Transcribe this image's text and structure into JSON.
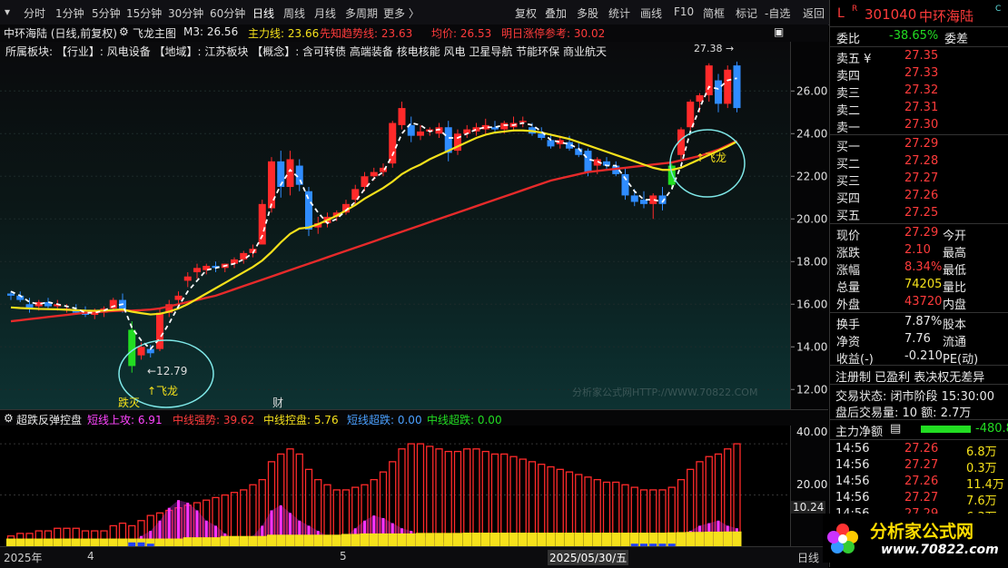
{
  "toolbar": {
    "left_tabs": [
      "分时",
      "1分钟",
      "5分钟",
      "15分钟",
      "30分钟",
      "60分钟",
      "日线",
      "周线",
      "月线",
      "多周期",
      "更多 〉"
    ],
    "active_tab": "日线",
    "right_tabs": [
      "复权",
      "叠加",
      "多股",
      "统计",
      "画线",
      "F10",
      "简框",
      "标记",
      "-自选",
      "返回"
    ]
  },
  "header": {
    "flag": "L",
    "flag_sup": "R",
    "code": "301040",
    "name": "中环海陆",
    "corner_mark": "C"
  },
  "infobar": {
    "title": "中环海陆 (日线,前复权)",
    "indicator": "飞龙主图",
    "m3": "M3: 26.56",
    "main_line": "主力线: 23.66",
    "trend_line": "先知趋势线: 23.63",
    "avg_price": "均价: 26.53",
    "tomorrow_ref": "明日涨停参考: 30.02"
  },
  "sector": "所属板块:  【行业】: 风电设备 【地域】: 江苏板块 【概念】: 含可转债 高端装备 核电核能 风电 卫星导航 节能环保 商业航天",
  "price_axis": [
    "26.00",
    "24.00",
    "22.00",
    "20.00",
    "18.00",
    "16.00",
    "14.00",
    "12.00"
  ],
  "annotations": {
    "high": "27.38",
    "low": "12.79",
    "feilong1": "飞龙",
    "feilong2": "飞龙",
    "die_mie": "跌灭",
    "cai": "财",
    "watermark": "分析家公式网HTTP://WWW.70822.COM"
  },
  "sub_indicator": {
    "name": "超跌反弹控盘",
    "short_up": "短线上攻: 6.91",
    "mid_strong": "中线强势: 39.62",
    "mid_control": "中线控盘: 5.76",
    "short_oversold": "短线超跌: 0.00",
    "mid_oversold": "中线超跌: 0.00"
  },
  "sub_axis": [
    "40.00",
    "20.00",
    "10.24"
  ],
  "dates": {
    "year": "2025年",
    "m4": "4",
    "m5": "5",
    "cursor": "2025/05/30/五",
    "right": "日线"
  },
  "orderbook": {
    "wei_bi_label": "委比",
    "wei_bi": "-38.65%",
    "wei_cha_label": "委差",
    "asks": [
      {
        "label": "卖五 ¥",
        "price": "27.35"
      },
      {
        "label": "卖四",
        "price": "27.33"
      },
      {
        "label": "卖三",
        "price": "27.32"
      },
      {
        "label": "卖二",
        "price": "27.31"
      },
      {
        "label": "卖一",
        "price": "27.30"
      }
    ],
    "bids": [
      {
        "label": "买一",
        "price": "27.29"
      },
      {
        "label": "买二",
        "price": "27.28"
      },
      {
        "label": "买三",
        "price": "27.27"
      },
      {
        "label": "买四",
        "price": "27.26"
      },
      {
        "label": "买五",
        "price": "27.25"
      }
    ]
  },
  "quote": {
    "rows": [
      {
        "l": "现价",
        "v": "27.29",
        "r": "今开"
      },
      {
        "l": "涨跌",
        "v": "2.10",
        "r": "最高"
      },
      {
        "l": "涨幅",
        "v": "8.34%",
        "r": "最低"
      },
      {
        "l": "总量",
        "v": "74205",
        "r": "量比"
      },
      {
        "l": "外盘",
        "v": "43720",
        "r": "内盘"
      }
    ],
    "rows2": [
      {
        "l": "换手",
        "v": "7.87%",
        "r": "股本"
      },
      {
        "l": "净资",
        "v": "7.76",
        "r": "流通"
      },
      {
        "l": "收益(-)",
        "v": "-0.210",
        "r": "PE(动)"
      }
    ],
    "reg": "注册制 已盈利 表决权无差异",
    "status": "交易状态: 闭市阶段 15:30:00",
    "after": "盘后交易量: 10  额: 2.7万",
    "netflow_label": "主力净额",
    "netflow": "-480.8"
  },
  "ticks": [
    {
      "t": "14:56",
      "p": "27.26",
      "v": "6.8万"
    },
    {
      "t": "14:56",
      "p": "27.27",
      "v": "0.3万"
    },
    {
      "t": "14:56",
      "p": "27.26",
      "v": "11.4万"
    },
    {
      "t": "14:56",
      "p": "27.27",
      "v": "7.6万"
    },
    {
      "t": "14:56",
      "p": "27.29",
      "v": "6.3万"
    }
  ],
  "logo": {
    "cn": "分析家公式网",
    "url": "www.70822.com"
  },
  "colors": {
    "up": "#ff2a2a",
    "down": "#2f8cff",
    "yellow": "#f5e11b",
    "white": "#ffffff",
    "magenta": "#ff33ff",
    "green": "#22dd22"
  },
  "chart_data": {
    "type": "candlestick",
    "ylim": [
      11.5,
      27.8
    ],
    "candles": [
      [
        16.5,
        16.6,
        16.2,
        16.4
      ],
      [
        16.4,
        16.6,
        16.1,
        16.2
      ],
      [
        16.0,
        16.3,
        15.6,
        15.8
      ],
      [
        15.9,
        16.2,
        15.7,
        16.1
      ],
      [
        16.1,
        16.3,
        15.8,
        15.9
      ],
      [
        15.9,
        16.2,
        15.7,
        16.0
      ],
      [
        15.8,
        16.0,
        15.6,
        15.8
      ],
      [
        15.7,
        16.0,
        15.5,
        15.6
      ],
      [
        15.6,
        15.9,
        15.4,
        15.5
      ],
      [
        15.5,
        15.8,
        15.3,
        15.7
      ],
      [
        15.6,
        15.9,
        15.4,
        15.8
      ],
      [
        15.8,
        16.3,
        15.7,
        16.2
      ],
      [
        16.2,
        16.5,
        15.6,
        15.7
      ],
      [
        14.8,
        15.2,
        12.79,
        13.1
      ],
      [
        13.6,
        14.2,
        13.4,
        14.0
      ],
      [
        13.9,
        14.1,
        13.5,
        13.7
      ],
      [
        13.9,
        15.8,
        13.8,
        15.6
      ],
      [
        15.6,
        16.2,
        15.4,
        16.0
      ],
      [
        16.2,
        16.6,
        16.0,
        16.4
      ],
      [
        17.1,
        17.5,
        16.8,
        17.3
      ],
      [
        17.5,
        17.9,
        17.2,
        17.7
      ],
      [
        17.6,
        17.9,
        17.4,
        17.8
      ],
      [
        17.8,
        18.0,
        17.5,
        17.7
      ],
      [
        17.7,
        17.9,
        17.5,
        17.9
      ],
      [
        17.9,
        18.2,
        17.7,
        18.1
      ],
      [
        18.1,
        18.5,
        17.9,
        18.4
      ],
      [
        18.4,
        18.8,
        18.2,
        18.6
      ],
      [
        18.8,
        20.9,
        18.8,
        20.7
      ],
      [
        20.5,
        22.9,
        20.3,
        22.7
      ],
      [
        22.7,
        23.2,
        21.0,
        21.5
      ],
      [
        21.5,
        23.2,
        21.1,
        22.8
      ],
      [
        22.5,
        22.8,
        21.3,
        21.6
      ],
      [
        21.3,
        21.5,
        19.2,
        19.5
      ],
      [
        19.6,
        20.1,
        19.3,
        19.8
      ],
      [
        19.8,
        20.3,
        19.6,
        20.1
      ],
      [
        20.1,
        20.4,
        19.9,
        20.3
      ],
      [
        20.3,
        20.9,
        20.2,
        20.7
      ],
      [
        20.9,
        21.6,
        20.7,
        21.4
      ],
      [
        21.5,
        22.2,
        21.3,
        22.0
      ],
      [
        22.0,
        22.4,
        21.8,
        22.2
      ],
      [
        22.2,
        22.6,
        22.0,
        22.4
      ],
      [
        22.6,
        24.6,
        22.4,
        24.5
      ],
      [
        24.4,
        25.5,
        24.2,
        25.2
      ],
      [
        24.4,
        24.8,
        23.6,
        23.9
      ],
      [
        23.9,
        24.4,
        23.7,
        24.1
      ],
      [
        24.1,
        24.3,
        23.9,
        24.2
      ],
      [
        24.0,
        24.5,
        23.8,
        24.3
      ],
      [
        24.3,
        24.6,
        22.7,
        23.1
      ],
      [
        23.2,
        24.2,
        23.0,
        24.0
      ],
      [
        24.0,
        24.4,
        23.8,
        24.2
      ],
      [
        24.1,
        24.5,
        23.9,
        24.3
      ],
      [
        24.2,
        24.7,
        24.0,
        24.4
      ],
      [
        24.3,
        24.6,
        24.1,
        24.2
      ],
      [
        24.2,
        24.6,
        24.0,
        24.5
      ],
      [
        24.3,
        24.8,
        24.1,
        24.5
      ],
      [
        24.6,
        24.8,
        24.3,
        24.6
      ],
      [
        24.3,
        24.5,
        23.9,
        24.0
      ],
      [
        24.0,
        24.3,
        23.7,
        23.8
      ],
      [
        23.7,
        24.0,
        23.3,
        23.4
      ],
      [
        23.5,
        23.9,
        23.3,
        23.7
      ],
      [
        23.6,
        23.9,
        23.2,
        23.3
      ],
      [
        23.3,
        23.6,
        22.9,
        23.0
      ],
      [
        23.2,
        23.3,
        22.0,
        22.2
      ],
      [
        22.5,
        22.9,
        22.1,
        22.8
      ],
      [
        22.7,
        22.9,
        22.3,
        22.5
      ],
      [
        22.5,
        22.7,
        22.0,
        22.1
      ],
      [
        22.1,
        22.4,
        20.9,
        21.1
      ],
      [
        21.1,
        21.4,
        20.6,
        20.8
      ],
      [
        20.9,
        21.3,
        20.5,
        20.7
      ],
      [
        20.7,
        21.2,
        20.0,
        21.1
      ],
      [
        21.1,
        21.5,
        20.4,
        20.7
      ],
      [
        21.6,
        22.6,
        21.4,
        22.5
      ],
      [
        23.0,
        24.3,
        22.8,
        24.2
      ],
      [
        24.3,
        25.6,
        24.1,
        25.5
      ],
      [
        25.5,
        25.9,
        25.0,
        25.8
      ],
      [
        25.8,
        27.3,
        25.5,
        27.2
      ],
      [
        26.5,
        26.8,
        25.0,
        25.4
      ],
      [
        25.4,
        27.2,
        25.2,
        27.0
      ],
      [
        27.2,
        27.38,
        25.0,
        25.2
      ]
    ],
    "m3": [
      16.6,
      16.4,
      16.1,
      16.0,
      16.1,
      16.0,
      15.9,
      15.8,
      15.6,
      15.6,
      15.7,
      15.9,
      16.0,
      14.9,
      14.3,
      13.9,
      14.4,
      15.1,
      15.9,
      16.6,
      17.1,
      17.6,
      17.7,
      17.8,
      17.9,
      18.1,
      18.4,
      19.2,
      20.7,
      21.6,
      22.3,
      21.9,
      20.9,
      20.3,
      19.8,
      20.0,
      20.4,
      20.8,
      21.4,
      21.9,
      22.2,
      23.0,
      24.0,
      24.5,
      24.4,
      24.1,
      24.2,
      23.8,
      23.8,
      24.0,
      24.2,
      24.3,
      24.3,
      24.4,
      24.4,
      24.5,
      24.4,
      24.1,
      23.7,
      23.6,
      23.5,
      23.3,
      22.8,
      22.7,
      22.5,
      22.5,
      21.9,
      21.3,
      20.9,
      20.9,
      20.8,
      21.4,
      22.5,
      24.1,
      25.2,
      26.2,
      26.1,
      26.5,
      26.6
    ],
    "yellow_line": [
      15.85,
      15.82,
      15.8,
      15.78,
      15.77,
      15.76,
      15.74,
      15.72,
      15.7,
      15.69,
      15.7,
      15.73,
      15.75,
      15.65,
      15.58,
      15.52,
      15.55,
      15.65,
      15.8,
      16.0,
      16.25,
      16.5,
      16.75,
      17.0,
      17.25,
      17.5,
      17.75,
      18.05,
      18.45,
      18.9,
      19.3,
      19.55,
      19.6,
      19.75,
      19.95,
      20.15,
      20.4,
      20.65,
      20.95,
      21.2,
      21.45,
      21.75,
      22.1,
      22.35,
      22.55,
      22.8,
      23.0,
      23.2,
      23.4,
      23.6,
      23.8,
      23.95,
      24.05,
      24.1,
      24.15,
      24.15,
      24.12,
      24.05,
      23.95,
      23.85,
      23.75,
      23.6,
      23.45,
      23.3,
      23.15,
      23.0,
      22.85,
      22.7,
      22.55,
      22.4,
      22.3,
      22.3,
      22.4,
      22.6,
      22.8,
      23.0,
      23.2,
      23.4,
      23.63
    ],
    "red_line": [
      15.2,
      15.25,
      15.3,
      15.35,
      15.4,
      15.45,
      15.5,
      15.55,
      15.6,
      15.62,
      15.65,
      15.68,
      15.7,
      15.7,
      15.72,
      15.75,
      15.8,
      15.9,
      16.0,
      16.1,
      16.2,
      16.3,
      16.4,
      16.55,
      16.7,
      16.85,
      17.0,
      17.15,
      17.3,
      17.45,
      17.6,
      17.75,
      17.9,
      18.05,
      18.2,
      18.35,
      18.5,
      18.65,
      18.8,
      18.95,
      19.1,
      19.25,
      19.4,
      19.55,
      19.7,
      19.85,
      20.0,
      20.15,
      20.3,
      20.45,
      20.6,
      20.75,
      20.9,
      21.05,
      21.2,
      21.35,
      21.5,
      21.65,
      21.8,
      21.9,
      22.0,
      22.1,
      22.2,
      22.25,
      22.3,
      22.35,
      22.4,
      22.45,
      22.5,
      22.55,
      22.6,
      22.65,
      22.75,
      22.85,
      22.95,
      23.1,
      23.25,
      23.45,
      23.66
    ],
    "sub_ylim": [
      0,
      45
    ],
    "sub_red": [
      4,
      5,
      5,
      6,
      6,
      7,
      7,
      7,
      6,
      6,
      6,
      8,
      9,
      8,
      10,
      12,
      13,
      14,
      15,
      16,
      17,
      18,
      19,
      20,
      21,
      22,
      24,
      26,
      33,
      36,
      38,
      36,
      30,
      26,
      24,
      22,
      22,
      23,
      24,
      26,
      29,
      33,
      38,
      40,
      40,
      39,
      38,
      37,
      37,
      38,
      38,
      37,
      36,
      36,
      35,
      34,
      33,
      32,
      31,
      30,
      29,
      28,
      27,
      26,
      25,
      25,
      24,
      23,
      22,
      22,
      22,
      23,
      26,
      30,
      33,
      35,
      36,
      38,
      40
    ],
    "sub_magenta": [
      0,
      0,
      0,
      0,
      0,
      0,
      0,
      0,
      0,
      0,
      0,
      0,
      0,
      2,
      4,
      6,
      10,
      15,
      18,
      17,
      14,
      10,
      8,
      5,
      3,
      2,
      4,
      8,
      14,
      16,
      13,
      10,
      8,
      6,
      4,
      3,
      4,
      7,
      10,
      12,
      11,
      9,
      7,
      6,
      4,
      3,
      2,
      1,
      0,
      0,
      0,
      0,
      0,
      0,
      0,
      0,
      0,
      0,
      0,
      0,
      0,
      0,
      0,
      0,
      0,
      0,
      0,
      0,
      0,
      0,
      0,
      2,
      4,
      6,
      8,
      9,
      10,
      8,
      7
    ],
    "sub_yellow": [
      3,
      3,
      3,
      3,
      3,
      3,
      3,
      3,
      3,
      3,
      3,
      3,
      3,
      3,
      3,
      3,
      3,
      3,
      3,
      3.5,
      3.5,
      3.5,
      3.5,
      4,
      4,
      4,
      4,
      4,
      4.5,
      4.5,
      4.5,
      4.5,
      4.5,
      4.5,
      4.5,
      4.5,
      4.8,
      4.8,
      5,
      5,
      5,
      5,
      5,
      5,
      5.2,
      5.2,
      5.2,
      5.2,
      5.2,
      5.3,
      5.3,
      5.3,
      5.3,
      5.3,
      5.3,
      5.3,
      5.3,
      5.3,
      5.3,
      5.3,
      5.3,
      5.3,
      5.3,
      5.3,
      5.3,
      5.3,
      5.3,
      5.3,
      5.3,
      5.3,
      5.3,
      5.4,
      5.5,
      5.6,
      5.6,
      5.7,
      5.7,
      5.75,
      5.76
    ],
    "sub_blue": [
      0,
      0,
      0,
      0,
      0,
      0,
      0,
      0,
      0,
      0,
      0,
      0,
      0,
      1.5,
      1.5,
      1,
      0,
      0,
      0,
      0,
      0,
      0,
      0,
      0,
      0,
      0,
      0,
      0,
      0,
      0,
      0,
      0,
      0,
      0,
      0,
      0,
      0,
      0,
      0,
      0,
      0,
      0,
      0,
      0,
      0,
      0,
      0,
      0,
      0,
      0,
      0,
      0,
      0,
      0,
      0,
      0,
      0,
      0,
      0,
      0,
      0,
      0,
      0,
      0,
      0,
      0,
      0,
      1,
      1,
      1,
      1,
      1,
      0,
      0,
      0,
      0,
      0,
      0,
      0,
      0
    ]
  }
}
